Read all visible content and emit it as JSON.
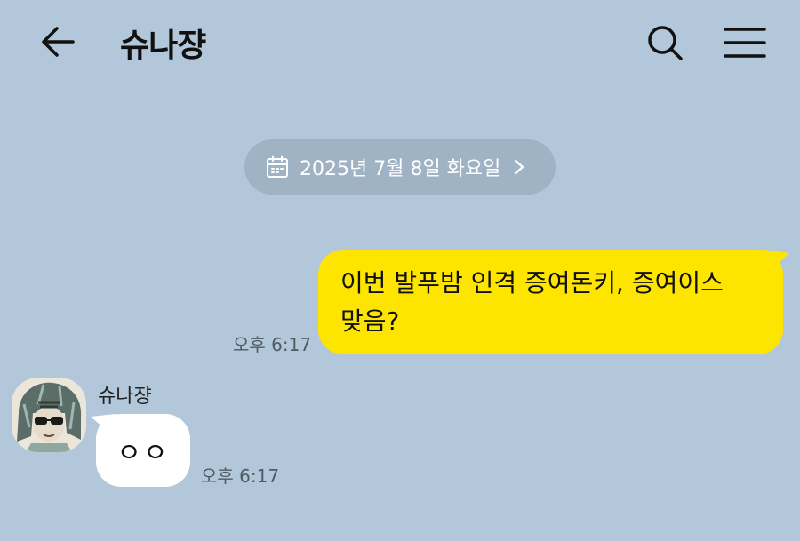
{
  "header": {
    "title": "슈나쟝",
    "back_icon": "arrow-left-icon",
    "search_icon": "search-icon",
    "menu_icon": "hamburger-menu-icon"
  },
  "date_divider": {
    "label": "2025년 7월 8일 화요일",
    "icon": "calendar-icon",
    "chevron": "chevron-right-icon"
  },
  "messages": [
    {
      "sender": "me",
      "text_line1": "이번 발푸밤 인격 증여돈키, 증여이스",
      "text_line2": "맞음?",
      "time": "오후 6:17",
      "bubble_color": "#fee500"
    },
    {
      "sender": "them",
      "sender_name": "슈나쟝",
      "text": "ㅇㅇ",
      "time": "오후 6:17",
      "bubble_color": "#ffffff"
    }
  ],
  "colors": {
    "background": "#b2c7da",
    "date_pill": "#9fb3c5"
  }
}
